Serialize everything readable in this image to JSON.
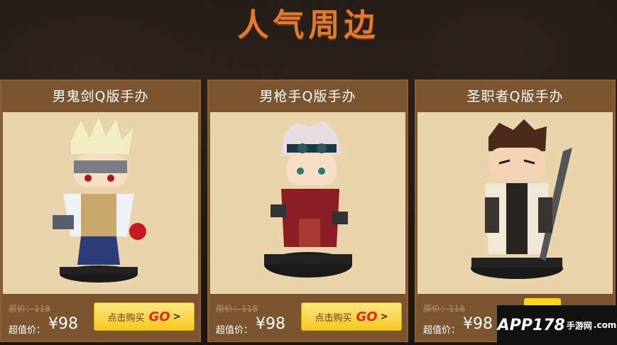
{
  "header": {
    "title": "人气周边"
  },
  "products": [
    {
      "name": "男鬼剑Q版手办",
      "original_price": "原价：118",
      "deal_label": "超值价：",
      "deal_price": "¥98",
      "buy_label": "点击购买",
      "go_label": "GO",
      "arrow": ">"
    },
    {
      "name": "男枪手Q版手办",
      "original_price": "原价：118",
      "deal_label": "超值价：",
      "deal_price": "¥98",
      "buy_label": "点击购买",
      "go_label": "GO",
      "arrow": ">"
    },
    {
      "name": "圣职者Q版手办",
      "original_price": "原价：118",
      "deal_label": "超值价：",
      "deal_price": "¥98",
      "buy_label": "",
      "go_label": "",
      "arrow": ""
    }
  ],
  "watermark": {
    "brand": "APP178",
    "sub": "手游网",
    "domain": ".com"
  },
  "colors": {
    "title": "#e07a2e",
    "card": "#7a5530",
    "card_bg": "#ead4ac",
    "button": "#f5c820",
    "go": "#e02a1a"
  }
}
